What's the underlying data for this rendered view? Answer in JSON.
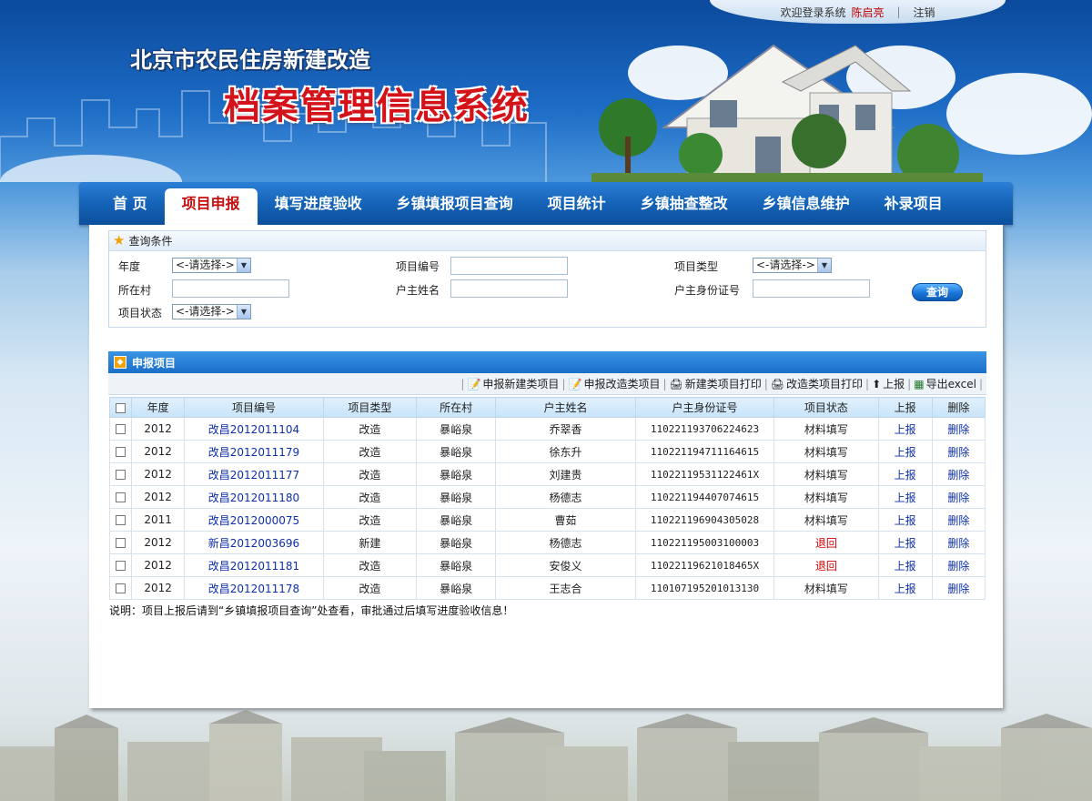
{
  "header": {
    "welcome": "欢迎登录系统",
    "user": "陈启亮",
    "logout": "注销",
    "title_line1": "北京市农民住房新建改造",
    "title_line2": "档案管理信息系统"
  },
  "nav": [
    {
      "label": "首 页",
      "active": false
    },
    {
      "label": "项目申报",
      "active": true
    },
    {
      "label": "填写进度验收",
      "active": false
    },
    {
      "label": "乡镇填报项目查询",
      "active": false
    },
    {
      "label": "项目统计",
      "active": false
    },
    {
      "label": "乡镇抽查整改",
      "active": false
    },
    {
      "label": "乡镇信息维护",
      "active": false
    },
    {
      "label": "补录项目",
      "active": false
    }
  ],
  "query": {
    "heading": "查询条件",
    "year_label": "年度",
    "project_no_label": "项目编号",
    "project_type_label": "项目类型",
    "village_label": "所在村",
    "owner_name_label": "户主姓名",
    "owner_id_label": "户主身份证号",
    "status_label": "项目状态",
    "select_placeholder": "<-请选择->",
    "search_button": "查询"
  },
  "list": {
    "heading": "申报项目",
    "toolbar": {
      "new_build": "申报新建类项目",
      "renovate": "申报改造类项目",
      "print_new": "新建类项目打印",
      "print_renovate": "改造类项目打印",
      "report": "上报",
      "export": "导出excel"
    },
    "columns": [
      "年度",
      "项目编号",
      "项目类型",
      "所在村",
      "户主姓名",
      "户主身份证号",
      "项目状态",
      "上报",
      "删除"
    ],
    "rows": [
      {
        "year": "2012",
        "no": "改昌2012011104",
        "type": "改造",
        "village": "暴峪泉",
        "owner": "乔翠香",
        "id": "110221193706224623",
        "status": "材料填写",
        "status_red": false,
        "report": "上报",
        "delete": "删除"
      },
      {
        "year": "2012",
        "no": "改昌2012011179",
        "type": "改造",
        "village": "暴峪泉",
        "owner": "徐东升",
        "id": "110221194711164615",
        "status": "材料填写",
        "status_red": false,
        "report": "上报",
        "delete": "删除"
      },
      {
        "year": "2012",
        "no": "改昌2012011177",
        "type": "改造",
        "village": "暴峪泉",
        "owner": "刘建贵",
        "id": "11022119531122461X",
        "status": "材料填写",
        "status_red": false,
        "report": "上报",
        "delete": "删除"
      },
      {
        "year": "2012",
        "no": "改昌2012011180",
        "type": "改造",
        "village": "暴峪泉",
        "owner": "杨德志",
        "id": "110221194407074615",
        "status": "材料填写",
        "status_red": false,
        "report": "上报",
        "delete": "删除"
      },
      {
        "year": "2011",
        "no": "改昌2012000075",
        "type": "改造",
        "village": "暴峪泉",
        "owner": "曹茹",
        "id": "110221196904305028",
        "status": "材料填写",
        "status_red": false,
        "report": "上报",
        "delete": "删除"
      },
      {
        "year": "2012",
        "no": "新昌2012003696",
        "type": "新建",
        "village": "暴峪泉",
        "owner": "杨德志",
        "id": "110221195003100003",
        "status": "退回",
        "status_red": true,
        "report": "上报",
        "delete": "删除"
      },
      {
        "year": "2012",
        "no": "改昌2012011181",
        "type": "改造",
        "village": "暴峪泉",
        "owner": "安俊义",
        "id": "11022119621018465X",
        "status": "退回",
        "status_red": true,
        "report": "上报",
        "delete": "删除"
      },
      {
        "year": "2012",
        "no": "改昌2012011178",
        "type": "改造",
        "village": "暴峪泉",
        "owner": "王志合",
        "id": "110107195201013130",
        "status": "材料填写",
        "status_red": false,
        "report": "上报",
        "delete": "删除"
      }
    ]
  },
  "note": "说明：项目上报后请到“乡镇填报项目查询”处查看，审批通过后填写进度验收信息！",
  "colors": {
    "accent": "#1a6fc9",
    "brand_red": "#d4121a",
    "link": "#0d2fa8"
  }
}
